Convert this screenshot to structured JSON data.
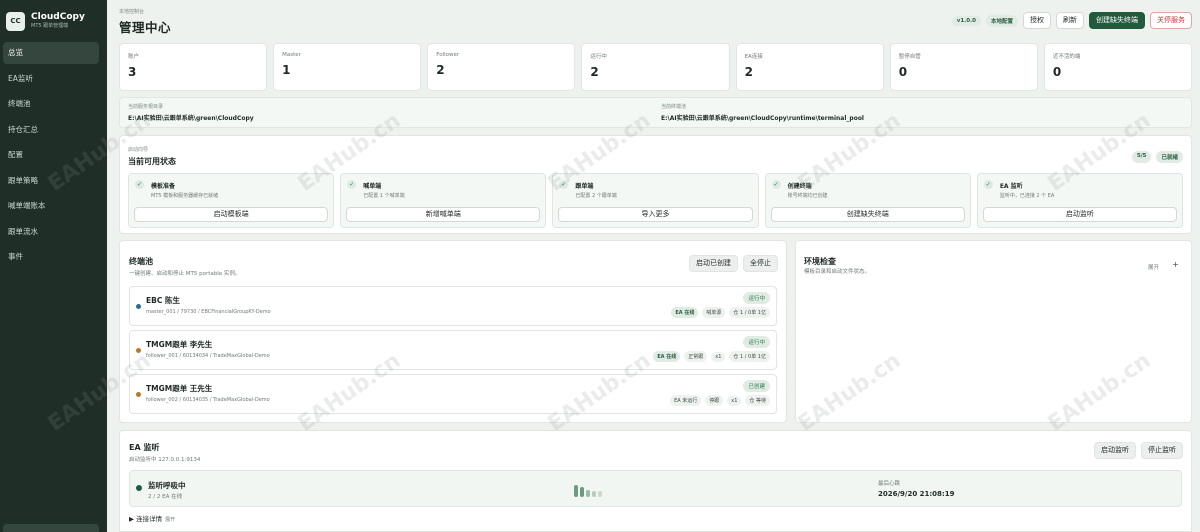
{
  "app": {
    "logo_text": "CC",
    "name": "CloudCopy",
    "subtitle": "MT5 跟单管理端"
  },
  "sidebar": {
    "items": [
      {
        "label": "总览",
        "active": true
      },
      {
        "label": "EA监听"
      },
      {
        "label": "终端池"
      },
      {
        "label": "持仓汇总"
      },
      {
        "label": "配置"
      },
      {
        "label": "跟单策略"
      },
      {
        "label": "喊单端账本"
      },
      {
        "label": "跟单流水"
      },
      {
        "label": "事件"
      }
    ]
  },
  "header": {
    "small": "本地控制台",
    "title": "管理中心",
    "version": "v1.0.0",
    "mode": "本地配置",
    "buttons": {
      "auth": "授权",
      "refresh": "刷新",
      "create_missing": "创建缺失终端",
      "shutdown": "关停服务"
    }
  },
  "stats": [
    {
      "label": "账户",
      "value": "3"
    },
    {
      "label": "Master",
      "value": "1"
    },
    {
      "label": "Follower",
      "value": "2"
    },
    {
      "label": "运行中",
      "value": "2"
    },
    {
      "label": "EA连接",
      "value": "2"
    },
    {
      "label": "暂停自管",
      "value": "0"
    },
    {
      "label": "近不活的端",
      "value": "0"
    }
  ],
  "paths": {
    "service_label": "当前服务根目录",
    "service_value": "E:\\AI实验田\\云跟单系统\\green\\CloudCopy",
    "pool_label": "当前终端池",
    "pool_value": "E:\\AI实验田\\云跟单系统\\green\\CloudCopy\\runtime\\terminal_pool"
  },
  "wizard": {
    "small": "启动向导",
    "title": "当前可用状态",
    "progress": "5/5",
    "done_label": "已就绪",
    "steps": [
      {
        "title": "模板准备",
        "desc": "MT5 模板和服务器缓存已就绪",
        "action": "启动模板端"
      },
      {
        "title": "喊单端",
        "desc": "已配置 1 个喊单端",
        "action": "新增喊单端"
      },
      {
        "title": "跟单端",
        "desc": "已配置 2 个跟单端",
        "action": "导入更多"
      },
      {
        "title": "创建终端",
        "desc": "账号终端均已创建",
        "action": "创建缺失终端"
      },
      {
        "title": "EA 监听",
        "desc": "监听中，已连接 2 个 EA",
        "action": "启动监听"
      }
    ]
  },
  "pool": {
    "title": "终端池",
    "subtitle": "一键创建、启动和停止 MT5 portable 实例。",
    "btn_start": "启动已创建",
    "btn_stop": "全停止",
    "terminals": [
      {
        "name": "EBC 陈生",
        "account": "master_001 / 79730 / EBCFinancialGroupKY-Demo",
        "status": "运行中",
        "dot": "#2b6e8f",
        "tags": [
          "EA 在线",
          "喊单源",
          "仓 1 / 0单 1亿"
        ]
      },
      {
        "name": "TMGM跟单 李先生",
        "account": "follower_001 / 60134034 / TradeMaxGlobal-Demo",
        "status": "运行中",
        "dot": "#b57a2a",
        "tags": [
          "EA 在线",
          "正常跟",
          "x1",
          "仓 1 / 0单 1亿"
        ]
      },
      {
        "name": "TMGM跟单 王先生",
        "account": "follower_002 / 60134035 / TradeMaxGlobal-Demo",
        "status": "已创建",
        "dot": "#b57a2a",
        "tags": [
          "EA 未运行",
          "停跟",
          "x1",
          "仓 等待"
        ]
      }
    ]
  },
  "env": {
    "title": "环境检查",
    "subtitle": "模板目录和启动文件状态。",
    "expand": "展开",
    "plus": "+"
  },
  "ea": {
    "title": "EA 监听",
    "subtitle": "启动监听中 127.0.0.1:9134",
    "btn_start": "启动监听",
    "btn_stop": "停止监听",
    "heartbeat_title": "监听呼吸中",
    "heartbeat_sub": "2 / 2 EA 在线",
    "last_label": "最后心跳",
    "last_value": "2026/9/20 21:08:19",
    "details": "▶ 连接详情",
    "details_expand": "展开"
  },
  "watermark": "EAHub.cn"
}
